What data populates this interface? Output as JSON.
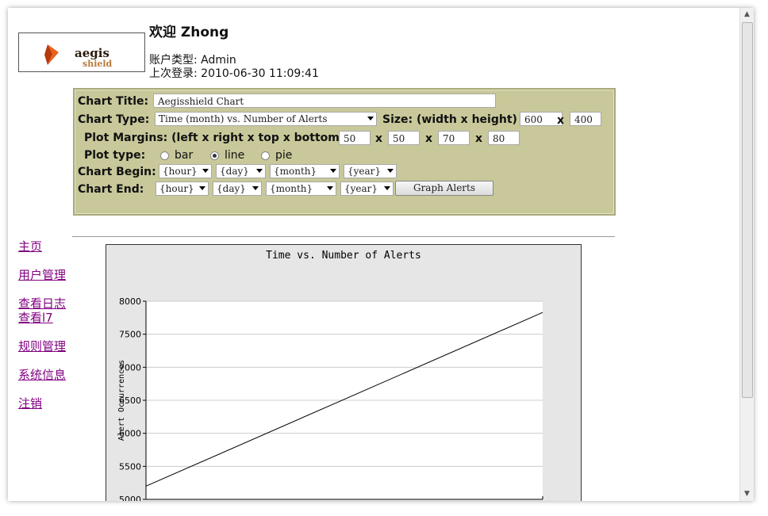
{
  "header": {
    "logo_text": "aegis shield",
    "welcome": "欢迎 Zhong",
    "account_type": "账户类型: Admin",
    "last_login": "上次登录: 2010-06-30 11:09:41"
  },
  "form": {
    "chart_title_label": "Chart Title:",
    "chart_title_value": "Aegisshield Chart",
    "chart_type_label": "Chart Type:",
    "chart_type_value": "Time (month) vs. Number of Alerts",
    "size_label": "Size: (width x height)",
    "size_width": "600",
    "size_x": "x",
    "size_height": "400",
    "margins_label": "Plot Margins: (left x right x top x bottom)",
    "margin_left": "50",
    "margin_right": "50",
    "margin_top": "70",
    "margin_bottom": "80",
    "plot_type_label": "Plot type:",
    "plot_types": [
      "bar",
      "line",
      "pie"
    ],
    "plot_type_selected": "line",
    "begin_label": "Chart Begin:",
    "end_label": "Chart End:",
    "hour": "{hour}",
    "day": "{day}",
    "month": "{month}",
    "year": "{year}",
    "graph_button": "Graph Alerts"
  },
  "nav": {
    "home": "主页",
    "users": "用户管理",
    "logs": "查看日志",
    "l7": "查看l7",
    "rules": "规则管理",
    "sysinfo": "系统信息",
    "logout": "注销"
  },
  "chart_data": {
    "type": "line",
    "title": "Time vs. Number of Alerts",
    "xlabel": "",
    "ylabel": "Alert Occurrences",
    "ylim": [
      5000,
      8000
    ],
    "yticks": [
      5000,
      5500,
      6000,
      6500,
      7000,
      7500,
      8000
    ],
    "ytick_labels": [
      "5000",
      "5500",
      "6000",
      "6500",
      "7000",
      "7500",
      "8000"
    ],
    "series": [
      {
        "x": [
          0,
          1
        ],
        "y": [
          5200,
          7830
        ]
      }
    ],
    "grid": true,
    "colors": {
      "line": "#000000",
      "plot_bg": "#ffffff",
      "chart_bg": "#e6e6e6",
      "grid": "#cccccc"
    }
  }
}
